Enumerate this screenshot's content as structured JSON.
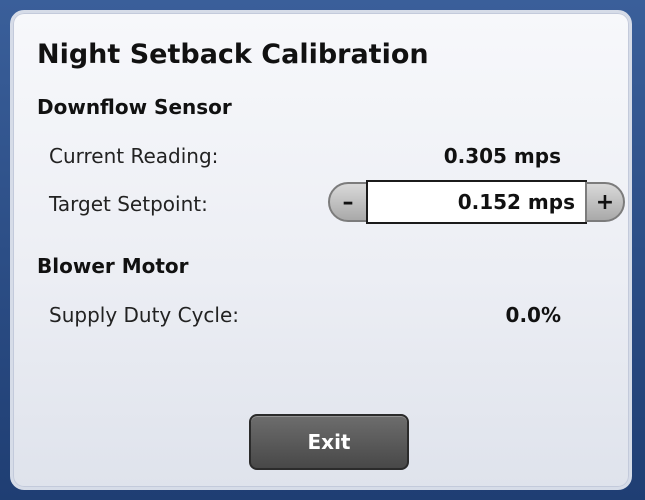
{
  "window": {
    "title": "Night Setback Calibration"
  },
  "downflow": {
    "heading": "Downflow Sensor",
    "current_label": "Current Reading:",
    "current_value": "0.305 mps",
    "target_label": "Target Setpoint:",
    "target_value": "0.152 mps",
    "minus_label": "–",
    "plus_label": "+"
  },
  "blower": {
    "heading": "Blower Motor",
    "duty_label": "Supply Duty Cycle:",
    "duty_value": "0.0%"
  },
  "actions": {
    "exit_label": "Exit"
  },
  "colors": {
    "frame_blue": "#2a4d86",
    "panel_bg": "#eceef4",
    "button_dark": "#555555"
  }
}
